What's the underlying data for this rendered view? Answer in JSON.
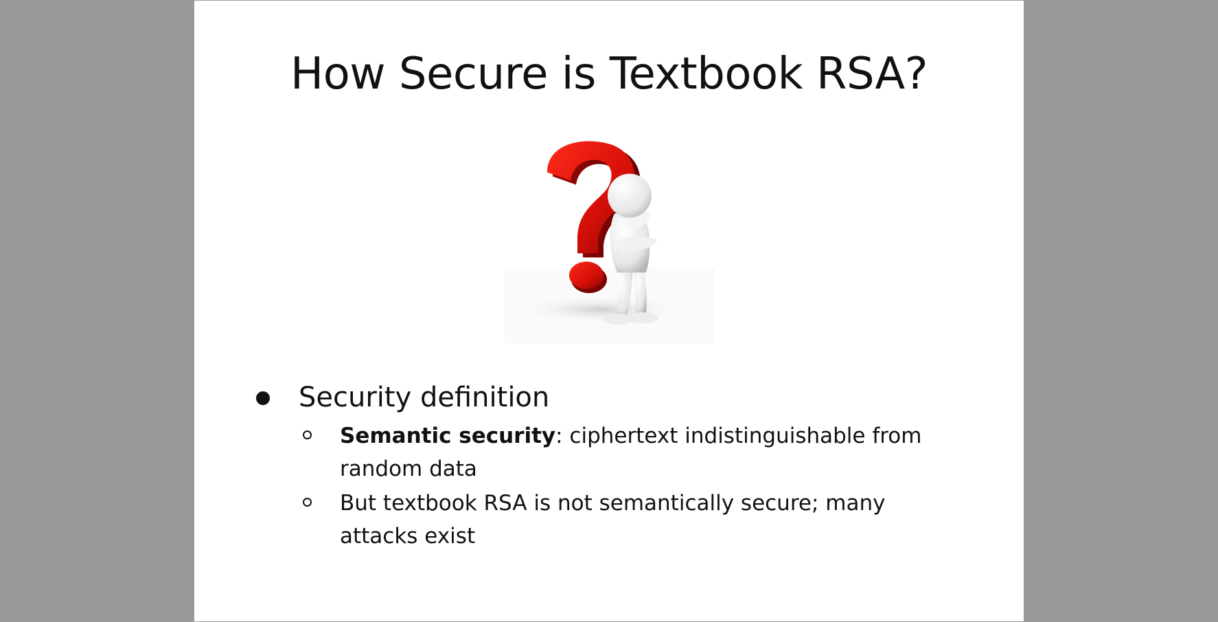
{
  "viewer": {
    "background_color": "#999999",
    "slide_color": "#ffffff"
  },
  "slide": {
    "title": "How Secure is Textbook RSA?",
    "illustration_icon": "question-mark-with-thinking-figure",
    "bullets": [
      {
        "text": "Security definition",
        "sub_bullets": [
          {
            "bold": "Semantic security",
            "text": ": ciphertext indistinguishable from random data"
          },
          {
            "bold": "",
            "text": "But textbook RSA is not semantically secure; many attacks exist"
          }
        ]
      }
    ]
  }
}
